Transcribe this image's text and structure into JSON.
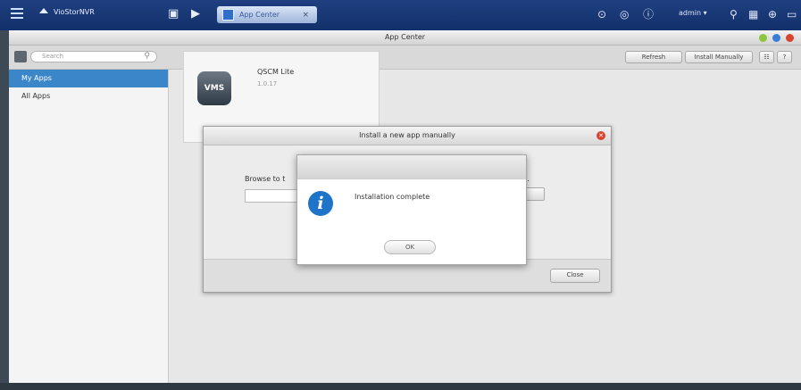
{
  "topbar": {
    "brand": "VioStorNVR",
    "active_tab": "App Center",
    "tab_close": "×",
    "user": "admin ▾"
  },
  "window": {
    "title": "App Center"
  },
  "toolbar": {
    "search_placeholder": "Search",
    "refresh_label": "Refresh",
    "install_manually_label": "Install Manually",
    "view_label": "☷",
    "help_label": "?"
  },
  "sidebar": {
    "items": [
      {
        "label": "My Apps",
        "selected": true
      },
      {
        "label": "All Apps",
        "selected": false
      }
    ]
  },
  "app_card": {
    "logo_text": "VMS",
    "name": "QSCM Lite",
    "version": "1.0.17"
  },
  "install_dialog": {
    "title": "Install a new app manually",
    "browse_text": "Browse to t",
    "hint_tail": "al).",
    "right_button_label": "al",
    "close_label": "Close",
    "close_icon": "close-icon"
  },
  "complete_dialog": {
    "message": "Installation complete",
    "ok_label": "OK",
    "icon": "info-icon"
  },
  "colors": {
    "topbar": "#12306a",
    "selected": "#3b86c9",
    "info": "#1f73c9",
    "danger": "#d8442f"
  }
}
